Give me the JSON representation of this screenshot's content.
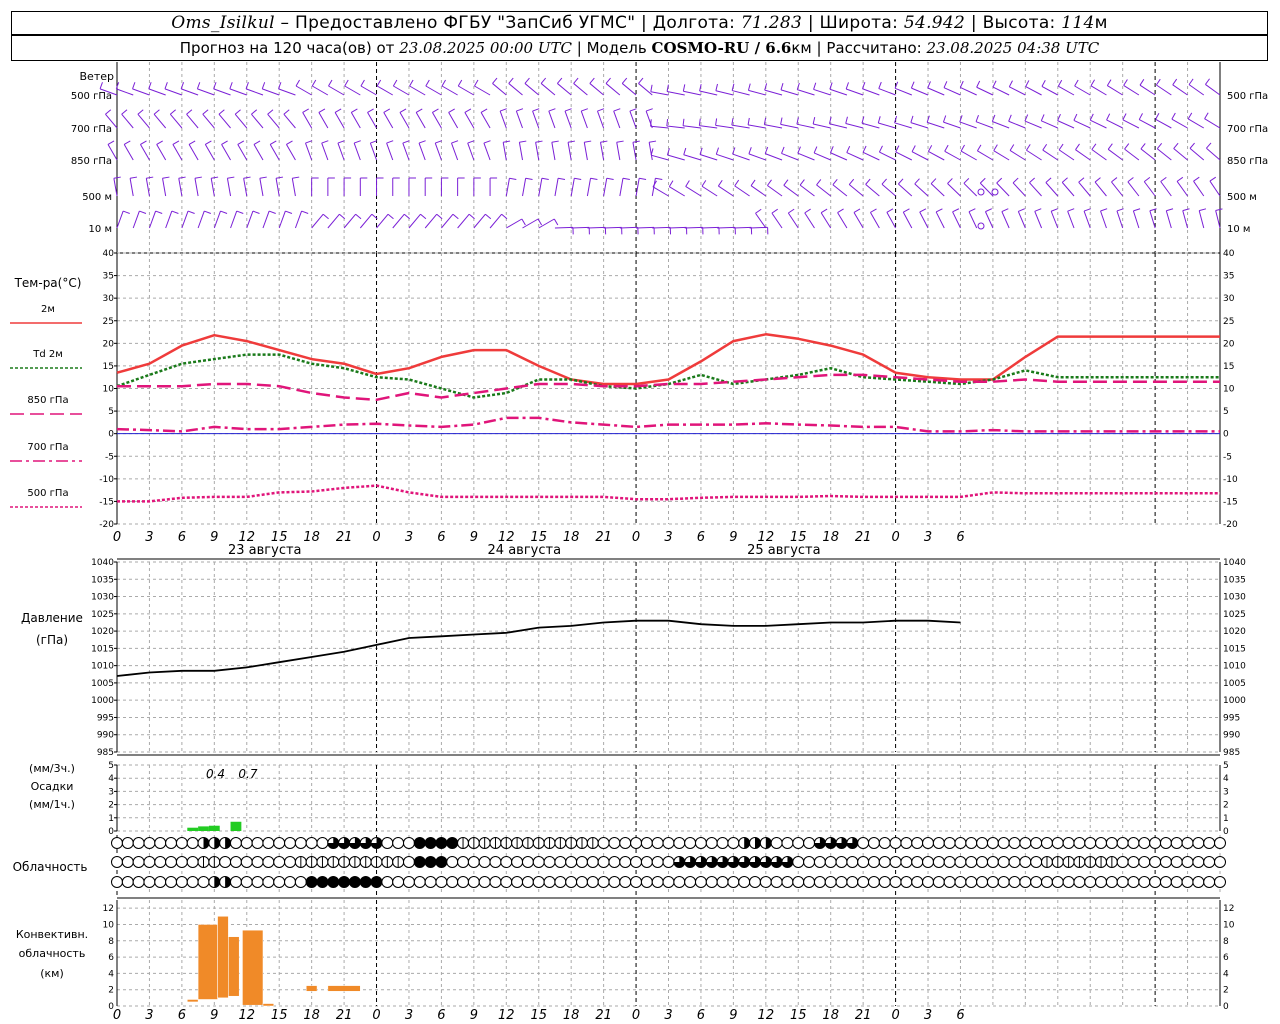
{
  "header": {
    "station": "Oms_Isilkul",
    "dash": " – ",
    "provider": "Предоставлено ФГБУ \"ЗапСиб УГМС\"",
    "lon_label": "Долгота:",
    "lon": "71.283",
    "lat_label": "Широта:",
    "lat": "54.942",
    "alt_label": "Высота:",
    "alt": "114",
    "alt_unit": "м",
    "sep": " | ",
    "forecast_label": "Прогноз на 120 часа(ов) от",
    "start": "23.08.2025 00:00 UTC",
    "model_label": "Модель",
    "model": "COSMO-RU / 6.6",
    "model_unit": "км",
    "calc_label": "Рассчитано:",
    "calc": "23.08.2025 04:38 UTC"
  },
  "wind": {
    "title": "Ветер",
    "levels": [
      "500 гПа",
      "700 гПа",
      "850 гПа",
      "500 м",
      "10  м"
    ]
  },
  "temp": {
    "title": "Тем-ра(°C)",
    "legend": [
      {
        "label": "2м",
        "color": "#ef3b3b",
        "dash": "none"
      },
      {
        "label": "Td 2м",
        "color": "#1a7a1a",
        "dash": "3,2"
      },
      {
        "label": "850 гПа",
        "color": "#e0157a",
        "dash": "14,6"
      },
      {
        "label": "700 гПа",
        "color": "#e0157a",
        "dash": "12,4,3,4"
      },
      {
        "label": "500 гПа",
        "color": "#e0157a",
        "dash": "3,2"
      }
    ],
    "yticks": [
      "40",
      "35",
      "30",
      "25",
      "20",
      "15",
      "10",
      "5",
      "0",
      "-5",
      "-10",
      "-15",
      "-20"
    ],
    "ylim": [
      -20,
      40
    ]
  },
  "xaxis": {
    "ticks": [
      "0",
      "3",
      "6",
      "9",
      "12",
      "15",
      "18",
      "21",
      "0",
      "3",
      "6",
      "9",
      "12",
      "15",
      "18",
      "21",
      "0",
      "3",
      "6",
      "9",
      "12",
      "15",
      "18",
      "21",
      "0",
      "3",
      "6"
    ],
    "days": [
      "23 августа",
      "24 августа",
      "25 августа"
    ]
  },
  "pressure": {
    "title": "Давление",
    "unit": "(гПа)",
    "yticks": [
      "1040",
      "1035",
      "1030",
      "1025",
      "1020",
      "1015",
      "1010",
      "1005",
      "1000",
      "995",
      "990",
      "985"
    ],
    "ylim": [
      985,
      1040
    ]
  },
  "precip": {
    "unit_top": "(мм/3ч.)",
    "title": "Осадки",
    "unit_bottom": "(мм/1ч.)",
    "yticks": [
      "5",
      "4",
      "3",
      "2",
      "1",
      "0"
    ],
    "labels": [
      {
        "h": 8,
        "text": "0.4"
      },
      {
        "h": 11,
        "text": "0.7"
      }
    ]
  },
  "clouds": {
    "title": "Облачность"
  },
  "convective": {
    "title1": "Конвективн.",
    "title2": "облачность",
    "unit": "(км)",
    "yticks": [
      "12",
      "10",
      "8",
      "6",
      "4",
      "2",
      "0"
    ]
  },
  "chart_data": [
    {
      "type": "line",
      "title": "Тем-ра(°C)",
      "x_hours": [
        0,
        3,
        6,
        9,
        12,
        15,
        18,
        21,
        24,
        27,
        30,
        33,
        36,
        39,
        42,
        45,
        48,
        51,
        54,
        57,
        60,
        63,
        66,
        69,
        72,
        75,
        78,
        81,
        84,
        87,
        90,
        93,
        96,
        99,
        102
      ],
      "series": [
        {
          "name": "2м",
          "values": [
            13.5,
            15.5,
            19.5,
            21.8,
            20.5,
            18.5,
            16.5,
            15.5,
            13.2,
            14.5,
            17,
            18.5,
            18.5,
            15,
            12,
            11,
            11,
            12,
            16,
            20.5,
            22,
            21,
            19.5,
            17.5,
            13.5,
            12.5,
            12,
            12,
            17,
            21.5,
            21.5,
            21.5,
            21.5,
            21.5,
            21.5
          ]
        },
        {
          "name": "Td 2м",
          "values": [
            10.5,
            13,
            15.5,
            16.5,
            17.5,
            17.5,
            15.5,
            14.5,
            12.5,
            12,
            10,
            8,
            9,
            12,
            12,
            10.5,
            10,
            11,
            13,
            11,
            12,
            13,
            14.5,
            12.5,
            12,
            11.5,
            11,
            12,
            14,
            12.5,
            12.5,
            12.5,
            12.5,
            12.5,
            12.5
          ]
        },
        {
          "name": "850 гПа",
          "values": [
            10.5,
            10.5,
            10.5,
            11,
            11,
            10.5,
            9,
            8,
            7.5,
            9,
            8,
            9,
            10,
            11,
            11,
            10.5,
            10.5,
            11,
            11,
            11.5,
            12,
            12.5,
            13,
            13,
            12.5,
            12,
            11.5,
            11.5,
            12,
            11.5,
            11.5,
            11.5,
            11.5,
            11.5,
            11.5
          ]
        },
        {
          "name": "700 гПа",
          "values": [
            1,
            0.8,
            0.5,
            1.5,
            1,
            1,
            1.5,
            2,
            2.2,
            1.8,
            1.5,
            2,
            3.5,
            3.5,
            2.5,
            2,
            1.5,
            2,
            2,
            2,
            2.3,
            2,
            1.8,
            1.5,
            1.5,
            0.5,
            0.5,
            0.8,
            0.5,
            0.5,
            0.5,
            0.5,
            0.5,
            0.5,
            0.5
          ]
        },
        {
          "name": "500 гПа",
          "values": [
            -15,
            -15,
            -14.2,
            -14,
            -14,
            -13,
            -12.8,
            -12,
            -11.5,
            -13,
            -14,
            -14,
            -14,
            -14,
            -14,
            -14,
            -14.5,
            -14.5,
            -14.2,
            -14,
            -14,
            -14,
            -13.8,
            -14,
            -14,
            -14,
            -14,
            -13,
            -13.2,
            -13.2,
            -13.2,
            -13.2,
            -13.2,
            -13.2,
            -13.2
          ]
        }
      ]
    },
    {
      "type": "line",
      "title": "Давление",
      "x_hours": [
        0,
        3,
        6,
        9,
        12,
        15,
        18,
        21,
        24,
        27,
        30,
        33,
        36,
        39,
        42,
        45,
        48,
        51,
        54,
        57,
        60,
        63,
        66,
        69,
        72,
        75,
        78
      ],
      "series": [
        {
          "name": "Давление",
          "values": [
            1007,
            1008,
            1008.5,
            1008.5,
            1009.5,
            1011,
            1012.5,
            1014,
            1016,
            1018,
            1018.5,
            1019,
            1019.5,
            1021,
            1021.5,
            1022.5,
            1023,
            1023,
            1022,
            1021.5,
            1021.5,
            1022,
            1022.5,
            1022.5,
            1023,
            1023,
            1022.5
          ]
        }
      ]
    },
    {
      "type": "bar",
      "title": "Осадки",
      "x_hours": [
        7,
        8,
        9,
        10,
        11
      ],
      "values": [
        0.25,
        0.35,
        0.4,
        0.0,
        0.7
      ]
    },
    {
      "type": "bar",
      "title": "Конвективн. облачность",
      "bars": [
        {
          "from": 6.5,
          "to": 7.5,
          "low": 0.5,
          "high": 0.8
        },
        {
          "from": 7.5,
          "to": 9.3,
          "low": 0.8,
          "high": 10
        },
        {
          "from": 9.3,
          "to": 10.3,
          "low": 1,
          "high": 11
        },
        {
          "from": 10.3,
          "to": 11.3,
          "low": 1.2,
          "high": 8.5
        },
        {
          "from": 11.6,
          "to": 13.5,
          "low": 0.1,
          "high": 9.3
        },
        {
          "from": 13.5,
          "to": 14.5,
          "low": 0,
          "high": 0.3
        },
        {
          "from": 17.5,
          "to": 18.5,
          "low": 1.8,
          "high": 2.5
        },
        {
          "from": 19.5,
          "to": 22.5,
          "low": 1.8,
          "high": 2.5
        }
      ]
    }
  ]
}
